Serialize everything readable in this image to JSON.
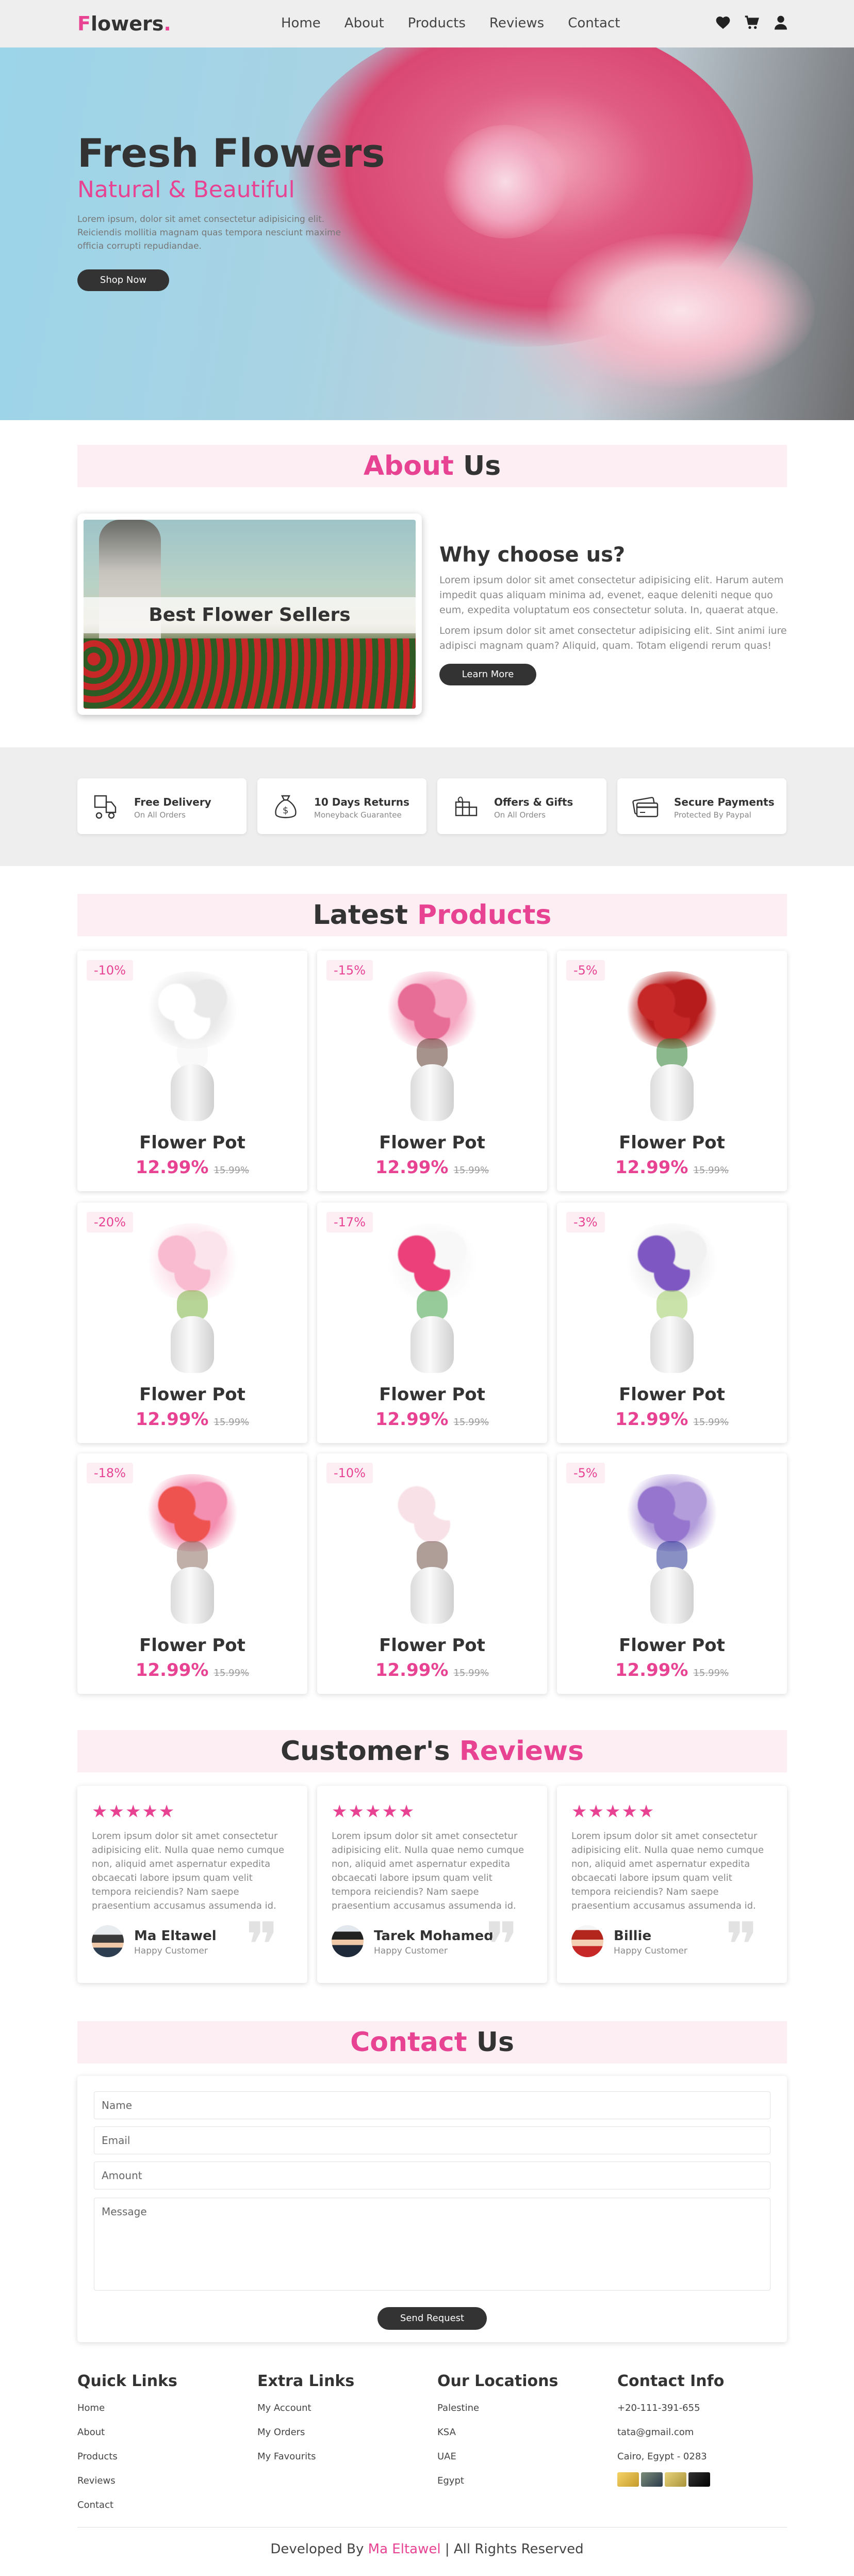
{
  "header": {
    "logo_first": "F",
    "logo_rest": "lowers",
    "logo_dot": ".",
    "menu": [
      "Home",
      "About",
      "Products",
      "Reviews",
      "Contact"
    ],
    "icons": [
      "heart-icon",
      "cart-icon",
      "user-icon"
    ]
  },
  "hero": {
    "title": "Fresh Flowers",
    "subtitle": "Natural & Beautiful",
    "text": "Lorem ipsum, dolor sit amet consectetur adipisicing elit. Reiciendis mollitia magnam quas tempora nesciunt maxime officia corrupti repudiandae.",
    "button": "Shop Now"
  },
  "about": {
    "heading_pink": "About",
    "heading_dark": "Us",
    "image_caption": "Best Flower Sellers",
    "why_title": "Why choose us?",
    "para1": "Lorem ipsum dolor sit amet consectetur adipisicing elit. Harum autem impedit quas aliquam minima ad, evenet, eaque deleniti neque quo eum, expedita voluptatum eos consectetur soluta. In, quaerat atque.",
    "para2": "Lorem ipsum dolor sit amet consectetur adipisicing elit. Sint animi iure adipisci magnam quam? Aliquid, quam. Totam eligendi rerum quas!",
    "button": "Learn More"
  },
  "features": [
    {
      "title": "Free Delivery",
      "sub": "On All Orders",
      "icon": "delivery-icon"
    },
    {
      "title": "10 Days Returns",
      "sub": "Moneyback Guarantee",
      "icon": "money-bag-icon"
    },
    {
      "title": "Offers & Gifts",
      "sub": "On All Orders",
      "icon": "gift-icon"
    },
    {
      "title": "Secure Payments",
      "sub": "Protected By Paypal",
      "icon": "credit-card-icon"
    }
  ],
  "products": {
    "heading_dark": "Latest",
    "heading_pink": "Products",
    "items": [
      {
        "discount": "-10%",
        "name": "Flower Pot",
        "price": "12.99%",
        "old": "15.99%"
      },
      {
        "discount": "-15%",
        "name": "Flower Pot",
        "price": "12.99%",
        "old": "15.99%"
      },
      {
        "discount": "-5%",
        "name": "Flower Pot",
        "price": "12.99%",
        "old": "15.99%"
      },
      {
        "discount": "-20%",
        "name": "Flower Pot",
        "price": "12.99%",
        "old": "15.99%"
      },
      {
        "discount": "-17%",
        "name": "Flower Pot",
        "price": "12.99%",
        "old": "15.99%"
      },
      {
        "discount": "-3%",
        "name": "Flower Pot",
        "price": "12.99%",
        "old": "15.99%"
      },
      {
        "discount": "-18%",
        "name": "Flower Pot",
        "price": "12.99%",
        "old": "15.99%"
      },
      {
        "discount": "-10%",
        "name": "Flower Pot",
        "price": "12.99%",
        "old": "15.99%"
      },
      {
        "discount": "-5%",
        "name": "Flower Pot",
        "price": "12.99%",
        "old": "15.99%"
      }
    ]
  },
  "reviews": {
    "heading_dark": "Customer's",
    "heading_pink": "Reviews",
    "stars": "★★★★★",
    "quote_mark": "❞",
    "items": [
      {
        "text": "Lorem ipsum dolor sit amet consectetur adipisicing elit. Nulla quae nemo cumque non, aliquid amet aspernatur expedita obcaecati labore ipsum quam velit tempora reiciendis? Nam saepe praesentium accusamus assumenda id.",
        "name": "Ma Eltawel",
        "sub": "Happy Customer"
      },
      {
        "text": "Lorem ipsum dolor sit amet consectetur adipisicing elit. Nulla quae nemo cumque non, aliquid amet aspernatur expedita obcaecati labore ipsum quam velit tempora reiciendis? Nam saepe praesentium accusamus assumenda id.",
        "name": "Tarek Mohamed",
        "sub": "Happy Customer"
      },
      {
        "text": "Lorem ipsum dolor sit amet consectetur adipisicing elit. Nulla quae nemo cumque non, aliquid amet aspernatur expedita obcaecati labore ipsum quam velit tempora reiciendis? Nam saepe praesentium accusamus assumenda id.",
        "name": "Billie",
        "sub": "Happy Customer"
      }
    ]
  },
  "contact": {
    "heading_pink": "Contact",
    "heading_dark": "Us",
    "name_placeholder": "Name",
    "email_placeholder": "Email",
    "amount_placeholder": "Amount",
    "message_placeholder": "Message",
    "button": "Send Request"
  },
  "footer": {
    "quick": {
      "title": "Quick Links",
      "links": [
        "Home",
        "About",
        "Products",
        "Reviews",
        "Contact"
      ]
    },
    "extra": {
      "title": "Extra Links",
      "links": [
        "My Account",
        "My Orders",
        "My Favourits"
      ]
    },
    "locations": {
      "title": "Our Locations",
      "links": [
        "Palestine",
        "KSA",
        "UAE",
        "Egypt"
      ]
    },
    "info": {
      "title": "Contact Info",
      "links": [
        "+20-111-391-655",
        "tata@gmail.com",
        "Cairo, Egypt - 0283"
      ]
    },
    "credit_prefix": "Developed By",
    "credit_name": "Ma Eltawel",
    "credit_suffix": "| All Rights Reserved"
  }
}
